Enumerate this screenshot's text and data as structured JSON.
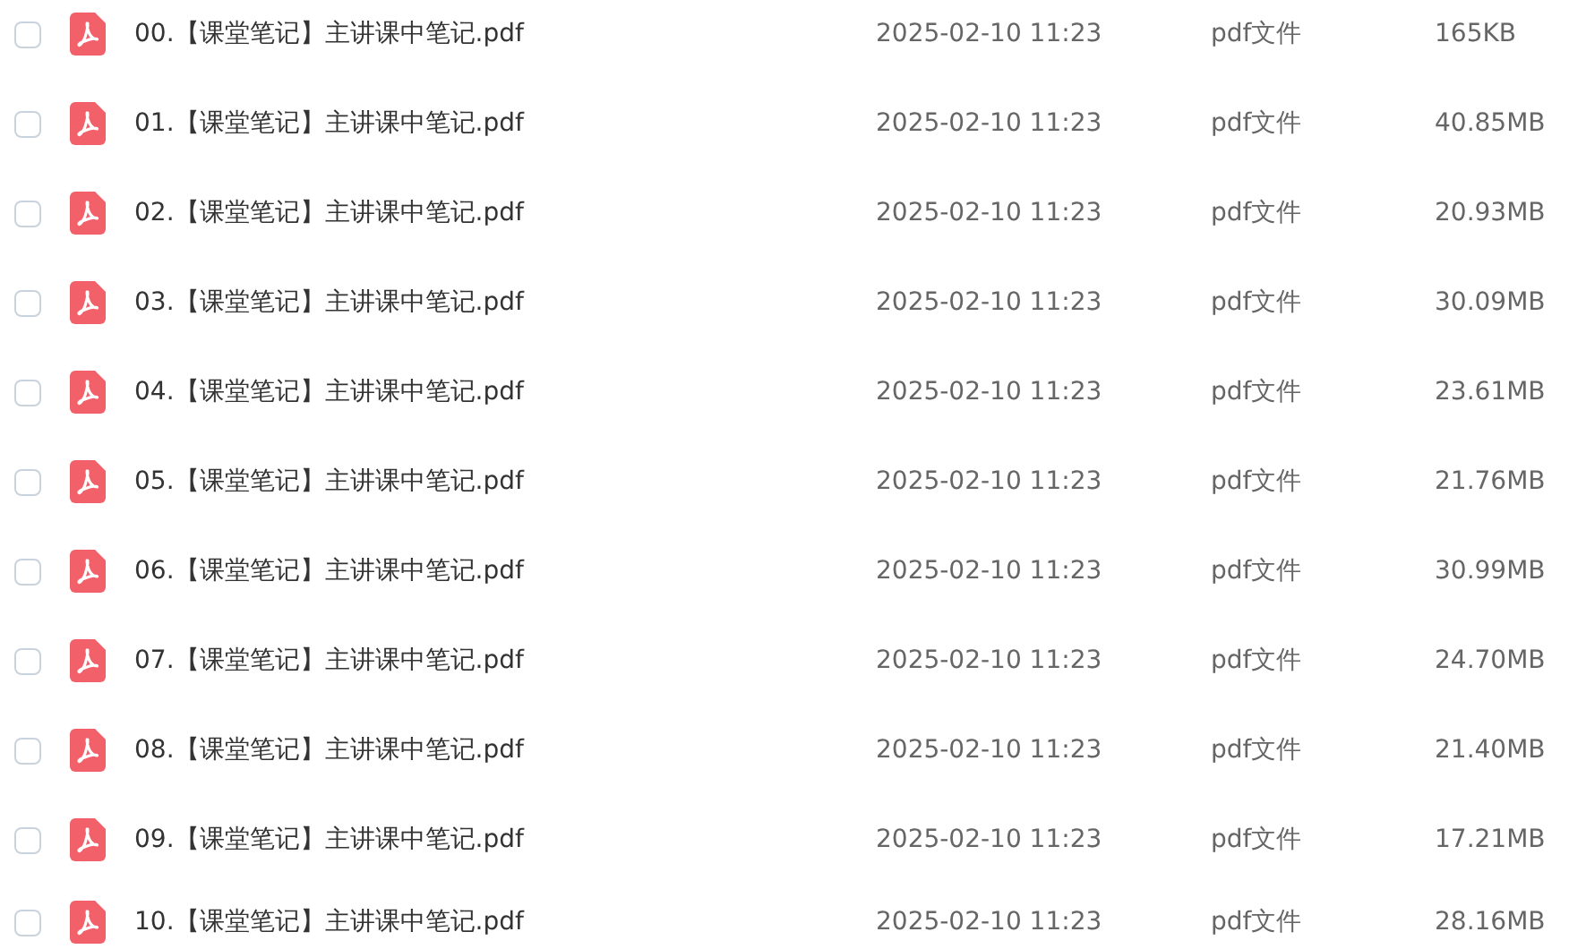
{
  "files": [
    {
      "name": "00.【课堂笔记】主讲课中笔记.pdf",
      "modified": "2025-02-10 11:23",
      "type": "pdf文件",
      "size": "165KB",
      "checked": false
    },
    {
      "name": "01.【课堂笔记】主讲课中笔记.pdf",
      "modified": "2025-02-10 11:23",
      "type": "pdf文件",
      "size": "40.85MB",
      "checked": false
    },
    {
      "name": "02.【课堂笔记】主讲课中笔记.pdf",
      "modified": "2025-02-10 11:23",
      "type": "pdf文件",
      "size": "20.93MB",
      "checked": false
    },
    {
      "name": "03.【课堂笔记】主讲课中笔记.pdf",
      "modified": "2025-02-10 11:23",
      "type": "pdf文件",
      "size": "30.09MB",
      "checked": false
    },
    {
      "name": "04.【课堂笔记】主讲课中笔记.pdf",
      "modified": "2025-02-10 11:23",
      "type": "pdf文件",
      "size": "23.61MB",
      "checked": false
    },
    {
      "name": "05.【课堂笔记】主讲课中笔记.pdf",
      "modified": "2025-02-10 11:23",
      "type": "pdf文件",
      "size": "21.76MB",
      "checked": false
    },
    {
      "name": "06.【课堂笔记】主讲课中笔记.pdf",
      "modified": "2025-02-10 11:23",
      "type": "pdf文件",
      "size": "30.99MB",
      "checked": false
    },
    {
      "name": "07.【课堂笔记】主讲课中笔记.pdf",
      "modified": "2025-02-10 11:23",
      "type": "pdf文件",
      "size": "24.70MB",
      "checked": false
    },
    {
      "name": "08.【课堂笔记】主讲课中笔记.pdf",
      "modified": "2025-02-10 11:23",
      "type": "pdf文件",
      "size": "21.40MB",
      "checked": false
    },
    {
      "name": "09.【课堂笔记】主讲课中笔记.pdf",
      "modified": "2025-02-10 11:23",
      "type": "pdf文件",
      "size": "17.21MB",
      "checked": false
    },
    {
      "name": "10.【课堂笔记】主讲课中笔记.pdf",
      "modified": "2025-02-10 11:23",
      "type": "pdf文件",
      "size": "28.16MB",
      "checked": false
    }
  ]
}
